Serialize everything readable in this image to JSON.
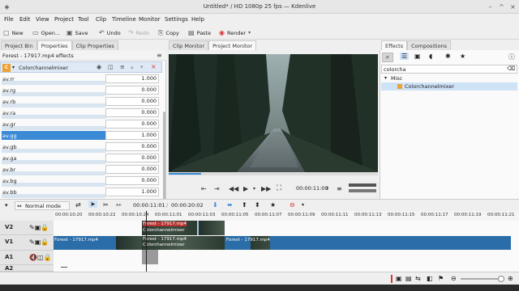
{
  "window": {
    "title": "Untitled* / HD 1080p 25 fps — Kdenlive"
  },
  "menu": [
    "File",
    "Edit",
    "View",
    "Project",
    "Tool",
    "Clip",
    "Timeline",
    "Monitor",
    "Settings",
    "Help"
  ],
  "toolbar": {
    "new": "New",
    "open": "Open...",
    "save": "Save",
    "undo": "Undo",
    "redo": "Redo",
    "copy": "Copy",
    "paste": "Paste",
    "render": "Render"
  },
  "left_tabs": [
    "Project Bin",
    "Properties",
    "Clip Properties"
  ],
  "effects_header": "Forest - 17917.mp4 effects",
  "effect": {
    "badge": "C",
    "name": "Colorchannelmixer"
  },
  "params": [
    {
      "name": "av.rr",
      "value": "1.000"
    },
    {
      "name": "av.rg",
      "value": "0.000"
    },
    {
      "name": "av.rb",
      "value": "0.000"
    },
    {
      "name": "av.ra",
      "value": "0.000"
    },
    {
      "name": "av.gr",
      "value": "0.000"
    },
    {
      "name": "av.gg",
      "value": "1.000"
    },
    {
      "name": "av.gb",
      "value": "0.000"
    },
    {
      "name": "av.ga",
      "value": "0.000"
    },
    {
      "name": "av.br",
      "value": "0.000"
    },
    {
      "name": "av.bg",
      "value": "0.000"
    },
    {
      "name": "av.bb",
      "value": "1.000"
    }
  ],
  "monitor_tabs": [
    "Clip Monitor",
    "Project Monitor"
  ],
  "monitor_timecode": "00:00:11:00",
  "right_tabs": [
    "Effects",
    "Compositions"
  ],
  "search_value": "colorcha",
  "tree": {
    "group": "Misc",
    "item": "Colorchannelmixer"
  },
  "timeline": {
    "mode": "Normal mode",
    "position": "00:00:11:01",
    "duration": "00:00:20:02",
    "ruler": [
      "00:00:10:20",
      "00:00:10:22",
      "00:00:10:24",
      "00:00:11:01",
      "00:00:11:03",
      "00:00:11:05",
      "00:00:11:07",
      "00:00:11:09",
      "00:00:11:11",
      "00:00:11:13",
      "00:00:11:15",
      "00:00:11:17",
      "00:00:11:19",
      "00:00:11:21"
    ],
    "tracks": [
      "V2",
      "V1",
      "A1",
      "A2"
    ],
    "clip_v2": "Forest - 17917.mp4",
    "clip_v2_effect": "Colorchannelmixer",
    "clip_v1a": "Forest - 17917.mp4",
    "clip_v1b": "Forest - 17917.mp4",
    "clip_v1b_effect": "Colorchannelmixer",
    "clip_v1c": "Forest - 17917.mp4"
  },
  "colors": {
    "accent": "#3a8ad6",
    "clip_v1": "#2a6da8",
    "clip_v2": "#a8c8e8",
    "selection": "#cfe3f7"
  }
}
